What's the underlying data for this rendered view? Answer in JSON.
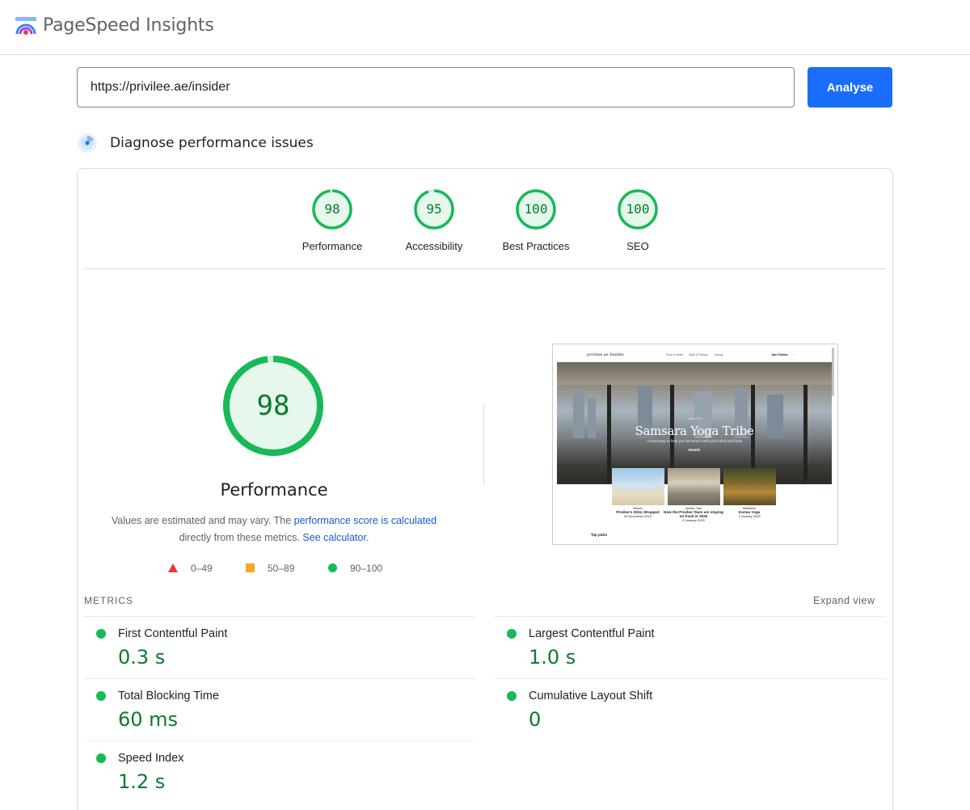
{
  "header": {
    "brand": "PageSpeed Insights",
    "logo_icon": "pagespeed-logo-icon"
  },
  "search": {
    "url_value": "https://privilee.ae/insider",
    "button_label": "Analyse"
  },
  "diagnose": {
    "title": "Diagnose performance issues",
    "icon": "diagnose-radar-icon"
  },
  "categories": [
    {
      "score": "98",
      "label": "Performance",
      "value": 98
    },
    {
      "score": "95",
      "label": "Accessibility",
      "value": 95
    },
    {
      "score": "100",
      "label": "Best Practices",
      "value": 100
    },
    {
      "score": "100",
      "label": "SEO",
      "value": 100
    }
  ],
  "performance": {
    "score": "98",
    "value": 98,
    "title": "Performance",
    "note_prefix": "Values are estimated and may vary. The ",
    "note_link1": "performance score is calculated",
    "note_mid": "directly from these metrics. ",
    "note_link2": "See calculator",
    "note_suffix": "."
  },
  "legend": {
    "fail": "0–49",
    "average": "50–89",
    "pass": "90–100"
  },
  "screenshot": {
    "logo": "privilee.ae Insider",
    "nav": [
      "Food & Drink",
      "Style & Fitness",
      "Dining"
    ],
    "join": "Join Privilee",
    "kicker": "Insider Pick",
    "title": "Samsara Yoga Tribe",
    "subtitle": "A sanctuary to help you reconnect with your mind and body",
    "button": "Details",
    "cards": [
      {
        "kicker": "Beach",
        "title": "Privilee's 2024, Wrapped",
        "date": "30 December 2024"
      },
      {
        "kicker": "Insider Tips",
        "title": "How the Privilee Team are staying on track in 2025",
        "date": "5 January 2025"
      },
      {
        "kicker": "Wellness",
        "title": "Karma Yoga",
        "date": "1 January 2025"
      }
    ],
    "top_picks": "Top picks"
  },
  "metrics": {
    "label": "METRICS",
    "expand": "Expand view",
    "items": [
      {
        "name": "First Contentful Paint",
        "value": "0.3 s"
      },
      {
        "name": "Largest Contentful Paint",
        "value": "1.0 s"
      },
      {
        "name": "Total Blocking Time",
        "value": "60 ms"
      },
      {
        "name": "Cumulative Layout Shift",
        "value": "0"
      },
      {
        "name": "Speed Index",
        "value": "1.2 s"
      }
    ]
  },
  "colors": {
    "pass": "#18b957",
    "pass_text": "#0a7a2f",
    "average": "#f9a825",
    "fail": "#e53935",
    "accent": "#1a6dfa"
  }
}
